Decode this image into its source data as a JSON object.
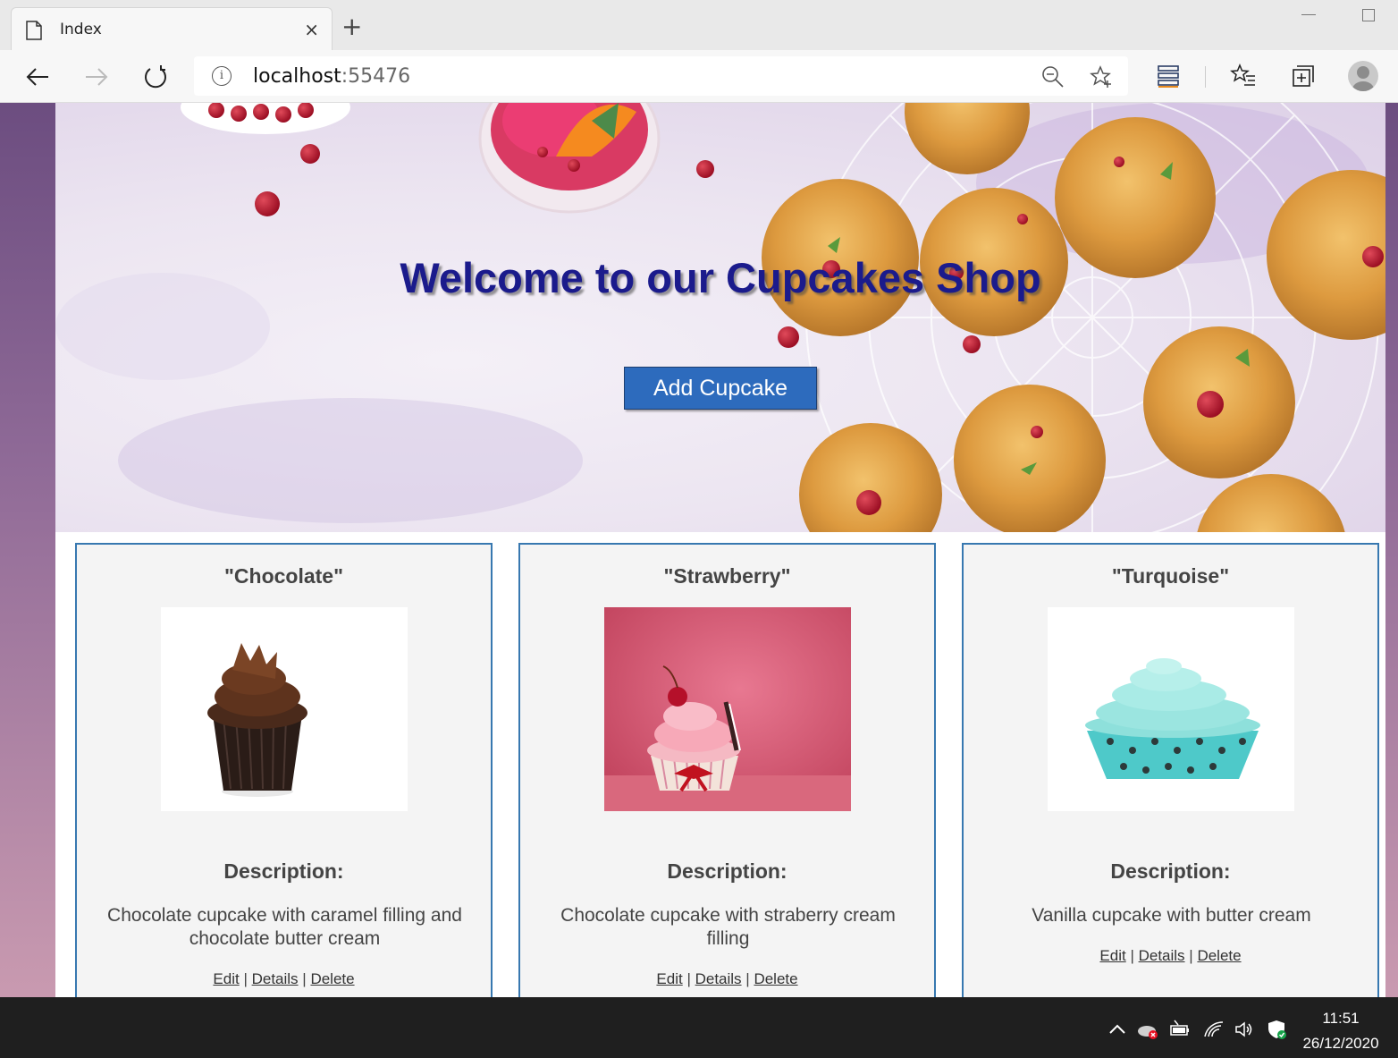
{
  "browser": {
    "tab_title": "Index",
    "tab_close": "×",
    "new_tab": "+",
    "address_host": "localhost",
    "address_port": ":55476",
    "info_glyph": "i"
  },
  "hero": {
    "title": "Welcome to our Cupcakes Shop",
    "add_button": "Add Cupcake"
  },
  "cupcakes": [
    {
      "name": "\"Chocolate\"",
      "description_heading": "Description:",
      "description": "Chocolate cupcake with caramel filling and chocolate butter cream",
      "links": {
        "edit": "Edit",
        "details": "Details",
        "delete": "Delete",
        "sep": " | "
      }
    },
    {
      "name": "\"Strawberry\"",
      "description_heading": "Description:",
      "description": "Chocolate cupcake with straberry cream filling",
      "links": {
        "edit": "Edit",
        "details": "Details",
        "delete": "Delete",
        "sep": " | "
      }
    },
    {
      "name": "\"Turquoise\"",
      "description_heading": "Description:",
      "description": "Vanilla cupcake with butter cream",
      "links": {
        "edit": "Edit",
        "details": "Details",
        "delete": "Delete",
        "sep": " | "
      }
    }
  ],
  "taskbar": {
    "time": "11:51",
    "date": "26/12/2020"
  },
  "colors": {
    "hero_title": "#1b1b8c",
    "add_button_bg": "#2d6bbd",
    "card_border": "#3778b0",
    "card_bg": "#f4f4f4"
  },
  "icons": [
    "page-icon",
    "back-icon",
    "forward-icon",
    "refresh-icon",
    "info-icon",
    "zoom-icon",
    "favorite-star-icon",
    "collections-icon",
    "favorites-list-icon",
    "extensions-icon",
    "profile-icon",
    "chevron-up-icon",
    "onedrive-icon",
    "battery-icon",
    "wifi-icon",
    "volume-icon",
    "security-shield-icon"
  ]
}
